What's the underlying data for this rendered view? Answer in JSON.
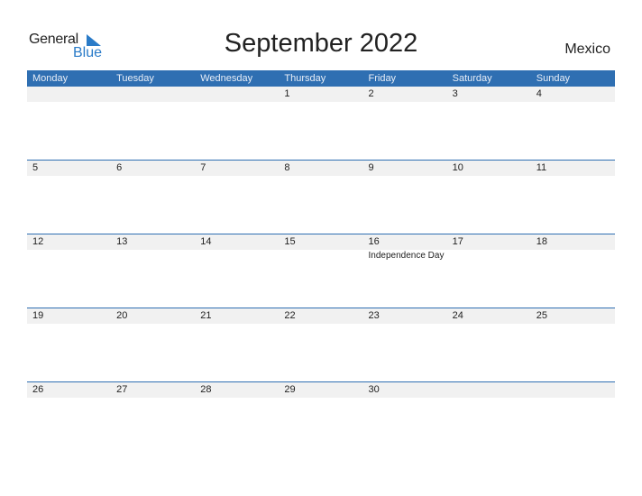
{
  "logo": {
    "line1": "General",
    "line2": "Blue"
  },
  "title": "September 2022",
  "country": "Mexico",
  "colors": {
    "header_bg": "#2f6fb2",
    "date_band": "#f1f1f1",
    "brand_blue": "#2a7bc8"
  },
  "weekdays": [
    "Monday",
    "Tuesday",
    "Wednesday",
    "Thursday",
    "Friday",
    "Saturday",
    "Sunday"
  ],
  "weeks": [
    {
      "days": [
        "",
        "",
        "",
        "1",
        "2",
        "3",
        "4"
      ],
      "holidays": [
        "",
        "",
        "",
        "",
        "",
        "",
        ""
      ]
    },
    {
      "days": [
        "5",
        "6",
        "7",
        "8",
        "9",
        "10",
        "11"
      ],
      "holidays": [
        "",
        "",
        "",
        "",
        "",
        "",
        ""
      ]
    },
    {
      "days": [
        "12",
        "13",
        "14",
        "15",
        "16",
        "17",
        "18"
      ],
      "holidays": [
        "",
        "",
        "",
        "",
        "Independence Day",
        "",
        ""
      ]
    },
    {
      "days": [
        "19",
        "20",
        "21",
        "22",
        "23",
        "24",
        "25"
      ],
      "holidays": [
        "",
        "",
        "",
        "",
        "",
        "",
        ""
      ]
    },
    {
      "days": [
        "26",
        "27",
        "28",
        "29",
        "30",
        "",
        ""
      ],
      "holidays": [
        "",
        "",
        "",
        "",
        "",
        "",
        ""
      ]
    }
  ]
}
